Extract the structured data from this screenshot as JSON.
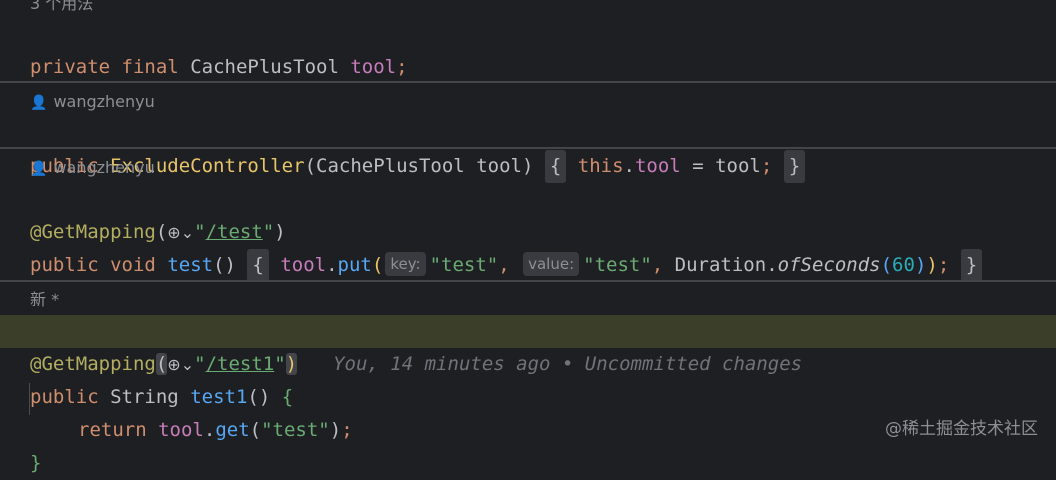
{
  "usages_hint": "3 个用法",
  "line_field": {
    "kw1": "private",
    "kw2": "final",
    "type": "CachePlusTool",
    "name": "tool",
    "semi": ";"
  },
  "author1": "wangzhenyu",
  "line_ctor": {
    "kw": "public",
    "name": "ExcludeController",
    "open": "(",
    "ptype": "CachePlusTool",
    "pname": "tool",
    "close": ")",
    "lbrace": "{",
    "this": "this",
    "dot": ".",
    "field": "tool",
    "eq": " = ",
    "val": "tool",
    "semi": ";",
    "rbrace": "}"
  },
  "author2": "wangzhenyu",
  "line_ann1": {
    "ann": "@GetMapping",
    "open": "(",
    "globe": "⊕",
    "chev": "⌄",
    "q1": "\"",
    "path": "/test",
    "q2": "\"",
    "close": ")"
  },
  "line_m1": {
    "kw1": "public",
    "kw2": "void",
    "name": "test",
    "parens": "()",
    "lbrace": "{",
    "obj": "tool",
    "dot": ".",
    "call": "put",
    "open": "(",
    "hint_key": "key:",
    "arg1": "\"test\"",
    "comma1": ",",
    "hint_value": "value:",
    "arg2": "\"test\"",
    "comma2": ", ",
    "cls": "Duration",
    "dot2": ".",
    "method": "ofSeconds",
    "p2open": "(",
    "num": "60",
    "p2close": ")",
    "close": ")",
    "semi": ";",
    "rbrace": "}"
  },
  "new_label": "新 *",
  "line_ann2": {
    "ann": "@GetMapping",
    "open": "(",
    "globe": "⊕",
    "chev": "⌄",
    "q1": "\"",
    "path": "/test1",
    "q2": "\"",
    "close": ")"
  },
  "blame": "You, 14 minutes ago • Uncommitted changes",
  "line_m2": {
    "kw1": "public",
    "type": "String",
    "name": "test1",
    "parens": "()",
    "lbrace": "{"
  },
  "line_ret": {
    "kw": "return",
    "obj": "tool",
    "dot": ".",
    "call": "get",
    "open": "(",
    "arg": "\"test\"",
    "close": ")",
    "semi": ";"
  },
  "line_end": {
    "rbrace": "}"
  },
  "watermark": "@稀土掘金技术社区"
}
